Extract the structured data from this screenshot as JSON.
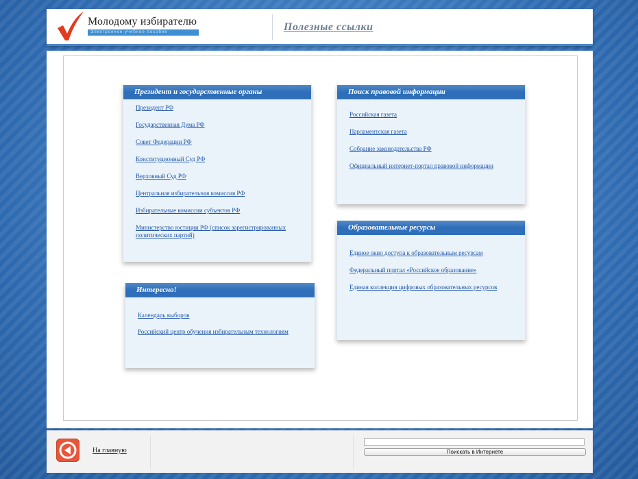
{
  "header": {
    "logo_title": "Молодому избирателю",
    "logo_subtitle": "Электронное учебное пособие",
    "page_title": "Полезные ссылки"
  },
  "cards": [
    {
      "title": "Президент и государственные органы",
      "links": [
        "Президент РФ",
        "Государственная Дума РФ",
        "Совет Федерации РФ",
        "Конституционный Суд РФ",
        "Верховный Суд РФ",
        "Центральная избирательная комиссия РФ",
        "Избирательные комиссии субъектов РФ",
        "Министерство юстиции РФ (список зарегистрированных политических партий)"
      ]
    },
    {
      "title": "Поиск правовой информации",
      "links": [
        "Российская газета",
        "Парламентская газета",
        "Собрание законодательства РФ",
        "Официальный интернет-портал правовой информации"
      ]
    },
    {
      "title": "Интересно!",
      "links": [
        "Календарь выборов",
        "Российский центр обучения избирательным технологиям"
      ]
    },
    {
      "title": "Образовательные ресурсы",
      "links": [
        "Единое окно доступа к образовательным ресурсам",
        "Федеральный портал «Российское образование»",
        "Единая коллекция цифровых образовательных ресурсов"
      ]
    }
  ],
  "footer": {
    "home_label": "На главную",
    "search_button_label": "Поискать в Интернете",
    "search_value": ""
  },
  "colors": {
    "accent": "#2f6fba",
    "logo_check": "#e23b1f",
    "home_button": "#e8563a"
  }
}
